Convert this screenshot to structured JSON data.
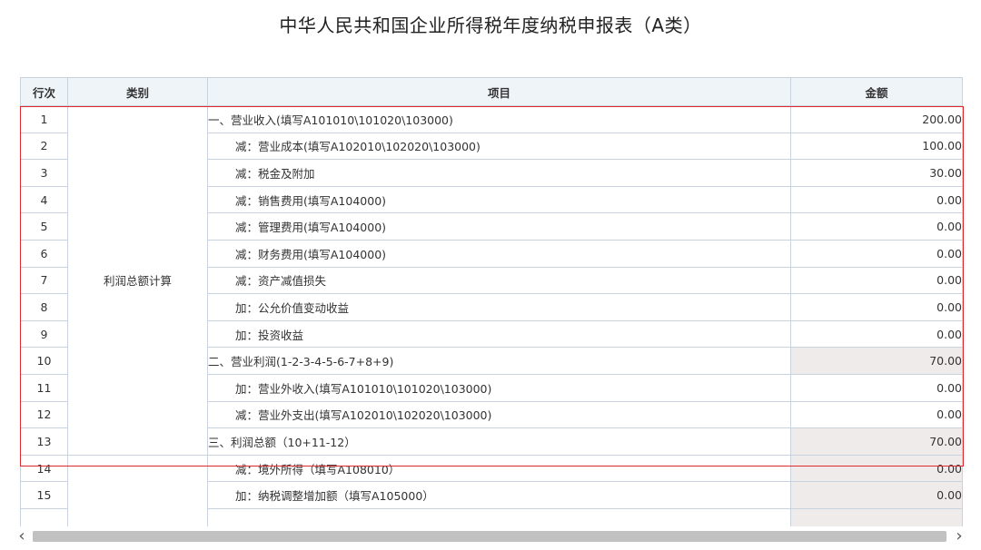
{
  "title": "中华人民共和国企业所得税年度纳税申报表（A类）",
  "headers": {
    "no": "行次",
    "category": "类别",
    "item": "项目",
    "amount": "金额"
  },
  "category_profit": "利润总额计算",
  "rows": [
    {
      "no": "1",
      "item": "一、营业收入(填写A101010\\101020\\103000)",
      "amount": "200.00"
    },
    {
      "no": "2",
      "item": "减：营业成本(填写A102010\\102020\\103000)",
      "amount": "100.00"
    },
    {
      "no": "3",
      "item": "减：税金及附加",
      "amount": "30.00"
    },
    {
      "no": "4",
      "item": "减：销售费用(填写A104000)",
      "amount": "0.00"
    },
    {
      "no": "5",
      "item": "减：管理费用(填写A104000)",
      "amount": "0.00"
    },
    {
      "no": "6",
      "item": "减：财务费用(填写A104000)",
      "amount": "0.00"
    },
    {
      "no": "7",
      "item": "减：资产减值损失",
      "amount": "0.00"
    },
    {
      "no": "8",
      "item": "加：公允价值变动收益",
      "amount": "0.00"
    },
    {
      "no": "9",
      "item": "加：投资收益",
      "amount": "0.00"
    },
    {
      "no": "10",
      "item": "二、营业利润(1-2-3-4-5-6-7+8+9)",
      "amount": "70.00"
    },
    {
      "no": "11",
      "item": "加：营业外收入(填写A101010\\101020\\103000)",
      "amount": "0.00"
    },
    {
      "no": "12",
      "item": "减：营业外支出(填写A102010\\102020\\103000)",
      "amount": "0.00"
    },
    {
      "no": "13",
      "item": "三、利润总额（10+11-12）",
      "amount": "70.00"
    },
    {
      "no": "14",
      "item": "减：境外所得（填写A108010）",
      "amount": "0.00"
    },
    {
      "no": "15",
      "item": "加：纳税调整增加额（填写A105000）",
      "amount": "0.00"
    }
  ],
  "scroll": {
    "left_icon": "chevron-left-icon",
    "right_icon": "chevron-right-icon",
    "left_glyph": "‹",
    "right_glyph": "›"
  },
  "colors": {
    "highlight": "#e0282e",
    "header_bg": "#eef4f8",
    "calc_bg": "#efebeb",
    "border": "#c8d3dd"
  }
}
